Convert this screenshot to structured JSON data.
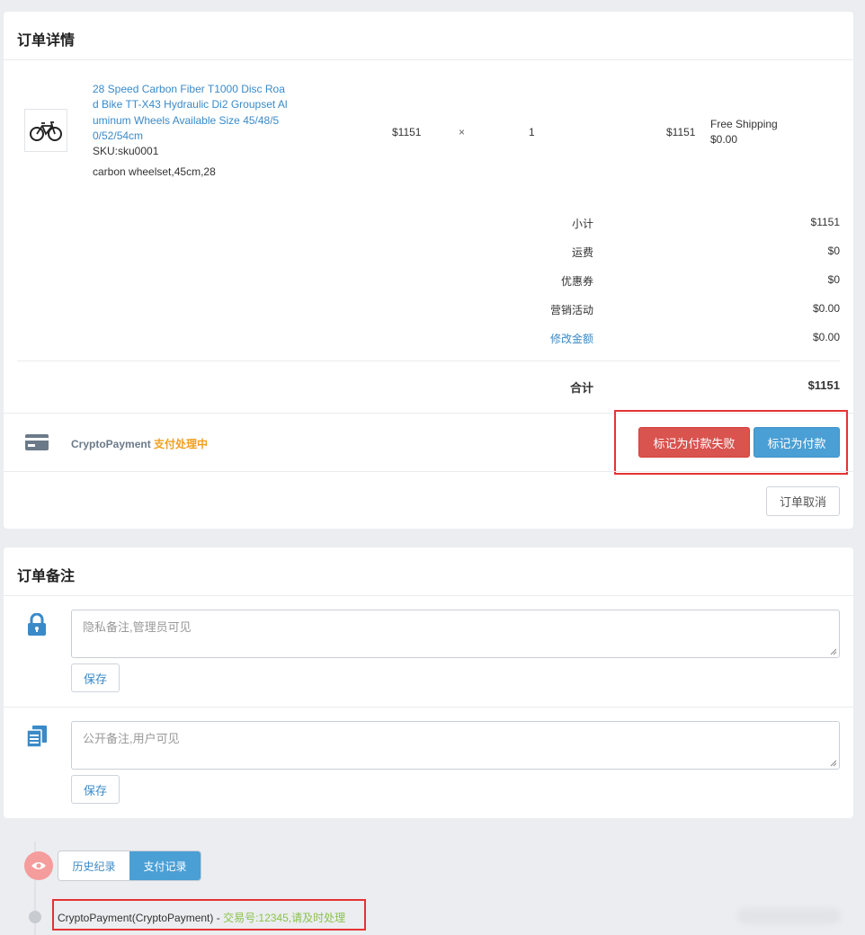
{
  "order_details": {
    "title": "订单详情",
    "product": {
      "name": "28 Speed Carbon Fiber T1000 Disc Road Bike TT-X43 Hydraulic Di2 Groupset Aluminum Wheels Available Size 45/48/50/52/54cm",
      "name_lines": [
        "28 Speed Carbon Fiber T1000 Disc Roa",
        "d Bike TT-X43 Hydraulic Di2 Groupset Al",
        "uminum Wheels Available Size 45/48/5",
        "0/52/54cm"
      ],
      "sku": "SKU:sku0001",
      "variant": "carbon wheelset,45cm,28",
      "unit_price": "$1151",
      "times": "×",
      "quantity": "1",
      "line_total": "$1151",
      "shipping_method": "Free Shipping",
      "shipping_cost": "$0.00"
    },
    "summary": [
      {
        "label": "小计",
        "value": "$1151"
      },
      {
        "label": "运费",
        "value": "$0"
      },
      {
        "label": "优惠券",
        "value": "$0"
      },
      {
        "label": "营销活动",
        "value": "$0.00"
      },
      {
        "label": "修改金额",
        "value": "$0.00"
      }
    ],
    "total": {
      "label": "合计",
      "value": "$1151"
    },
    "payment": {
      "method": "CryptoPayment",
      "status": "支付处理中",
      "status_color": "#f0a020",
      "mark_failed_label": "标记为付款失败",
      "mark_paid_label": "标记为付款"
    },
    "cancel_label": "订单取消"
  },
  "order_notes": {
    "title": "订单备注",
    "private": {
      "placeholder": "隐私备注,管理员可见",
      "save_label": "保存"
    },
    "public": {
      "placeholder": "公开备注,用户可见",
      "save_label": "保存"
    }
  },
  "timeline": {
    "tabs": [
      {
        "label": "历史纪录",
        "active": false
      },
      {
        "label": "支付记录",
        "active": true
      }
    ],
    "entry": {
      "method": "CryptoPayment(CryptoPayment) -",
      "transaction": "交易号:12345,请及时处理"
    }
  },
  "colors": {
    "accent": "#4a9fd5",
    "danger": "#d9534f",
    "link": "#3a8ac8",
    "success_text": "#8bc34a",
    "highlight_box": "#e53333"
  }
}
